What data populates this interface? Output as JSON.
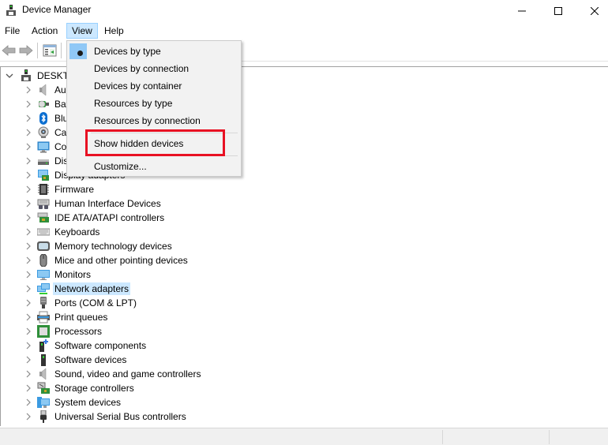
{
  "window": {
    "title": "Device Manager",
    "controls": {
      "minimize": "minimize",
      "maximize": "maximize",
      "close": "close"
    }
  },
  "menubar": {
    "items": [
      {
        "label": "File"
      },
      {
        "label": "Action"
      },
      {
        "label": "View",
        "active": true
      },
      {
        "label": "Help"
      }
    ]
  },
  "toolbar": {
    "buttons": [
      "back-arrow-icon",
      "forward-arrow-icon",
      "properties-pane-icon"
    ]
  },
  "tree": {
    "root": {
      "label": "DESKTOP",
      "expanded": true
    },
    "items": [
      {
        "label": "Audio inputs and outputs",
        "icon": "speaker-icon"
      },
      {
        "label": "Batteries",
        "icon": "battery-icon"
      },
      {
        "label": "Bluetooth",
        "icon": "bluetooth-icon"
      },
      {
        "label": "Cameras",
        "icon": "camera-icon"
      },
      {
        "label": "Computer",
        "icon": "computer-icon"
      },
      {
        "label": "Disk drives",
        "icon": "disk-drive-icon"
      },
      {
        "label": "Display adapters",
        "icon": "display-adapter-icon"
      },
      {
        "label": "Firmware",
        "icon": "firmware-chip-icon"
      },
      {
        "label": "Human Interface Devices",
        "icon": "hid-icon"
      },
      {
        "label": "IDE ATA/ATAPI controllers",
        "icon": "ide-controller-icon"
      },
      {
        "label": "Keyboards",
        "icon": "keyboard-icon"
      },
      {
        "label": "Memory technology devices",
        "icon": "memory-card-icon"
      },
      {
        "label": "Mice and other pointing devices",
        "icon": "mouse-icon"
      },
      {
        "label": "Monitors",
        "icon": "monitor-icon"
      },
      {
        "label": "Network adapters",
        "icon": "network-adapter-icon",
        "selected": true
      },
      {
        "label": "Ports (COM & LPT)",
        "icon": "port-icon"
      },
      {
        "label": "Print queues",
        "icon": "printer-icon"
      },
      {
        "label": "Processors",
        "icon": "processor-icon"
      },
      {
        "label": "Software components",
        "icon": "software-component-icon"
      },
      {
        "label": "Software devices",
        "icon": "software-device-icon"
      },
      {
        "label": "Sound, video and game controllers",
        "icon": "sound-icon"
      },
      {
        "label": "Storage controllers",
        "icon": "storage-controller-icon"
      },
      {
        "label": "System devices",
        "icon": "system-devices-icon"
      },
      {
        "label": "Universal Serial Bus controllers",
        "icon": "usb-icon"
      }
    ]
  },
  "view_menu": {
    "items": [
      {
        "label": "Devices by type",
        "checked": true
      },
      {
        "label": "Devices by connection"
      },
      {
        "label": "Devices by container"
      },
      {
        "label": "Resources by type"
      },
      {
        "label": "Resources by connection"
      },
      {
        "label": "Show hidden devices",
        "highlighted": true
      },
      {
        "label": "Customize..."
      }
    ]
  },
  "colors": {
    "highlight_box": "#e81123",
    "selection": "#cce8ff",
    "menu_check": "#90c8f6"
  }
}
